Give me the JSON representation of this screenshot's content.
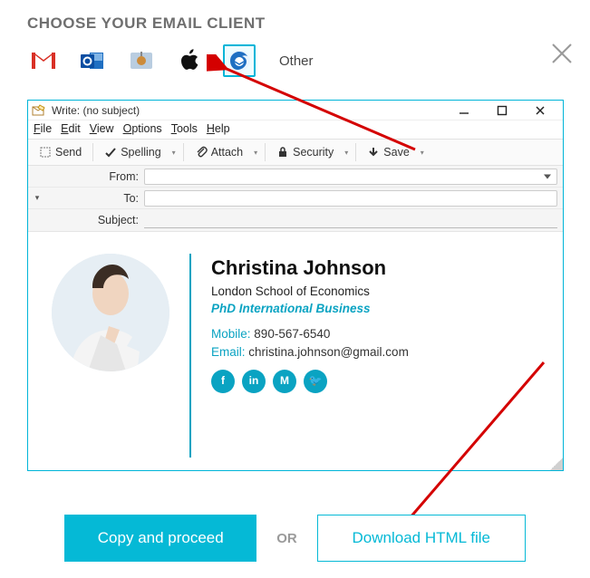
{
  "heading": "CHOOSE YOUR EMAIL CLIENT",
  "clients": {
    "gmail": "Gmail",
    "outlook": "Outlook",
    "applemail": "Apple Mail",
    "apple": "Apple",
    "thunderbird": "Thunderbird",
    "other_label": "Other"
  },
  "compose": {
    "title": "Write: (no subject)",
    "menu": {
      "file": "File",
      "edit": "Edit",
      "view": "View",
      "options": "Options",
      "tools": "Tools",
      "help": "Help"
    },
    "toolbar": {
      "send": "Send",
      "spelling": "Spelling",
      "attach": "Attach",
      "security": "Security",
      "save": "Save"
    },
    "headers": {
      "from_label": "From:",
      "to_label": "To:",
      "subject_label": "Subject:",
      "from_value": "",
      "to_value": "",
      "subject_value": ""
    }
  },
  "signature": {
    "name": "Christina Johnson",
    "org": "London School of Economics",
    "degree": "PhD International Business",
    "mobile_label": "Mobile:",
    "mobile_value": "890-567-6540",
    "email_label": "Email:",
    "email_value": "christina.johnson@gmail.com",
    "social": {
      "facebook": "f",
      "linkedin": "in",
      "medium": "M",
      "twitter": "t"
    }
  },
  "actions": {
    "copy": "Copy and proceed",
    "or": "OR",
    "download": "Download HTML file"
  }
}
